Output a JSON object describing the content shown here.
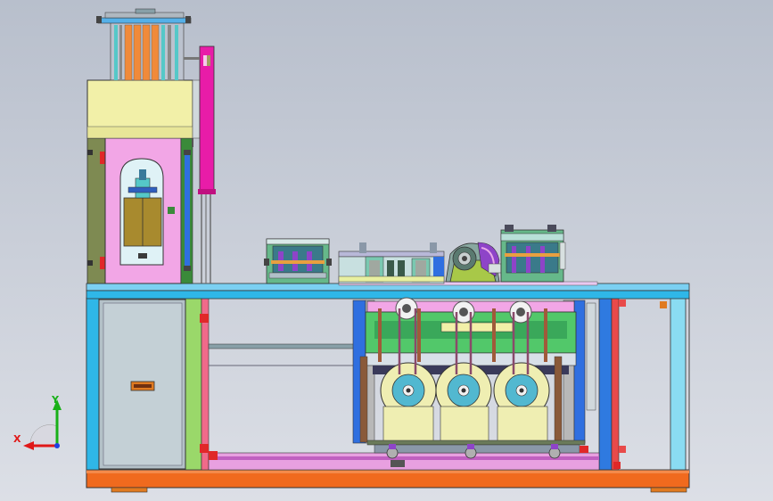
{
  "viewport": {
    "background_top": "#b8bfcc",
    "background_bottom": "#dcdfe6"
  },
  "triad": {
    "x_label": "X",
    "y_label": "Y",
    "x_color": "#e01818",
    "y_color": "#18b018",
    "z_color": "#2040e0"
  },
  "palette": {
    "frame_blue": "#33b8e8",
    "base_orange": "#f06a1e",
    "cabinet_gray": "#b4c1c8",
    "cream": "#f2f0a8",
    "pink": "#f2a6e6",
    "magenta": "#e81ca8",
    "olive": "#7e8a52",
    "green": "#52c86a",
    "roller_yellow": "#efeeb2",
    "purple": "#8e44c8",
    "gray_blue": "#8a98a8"
  }
}
